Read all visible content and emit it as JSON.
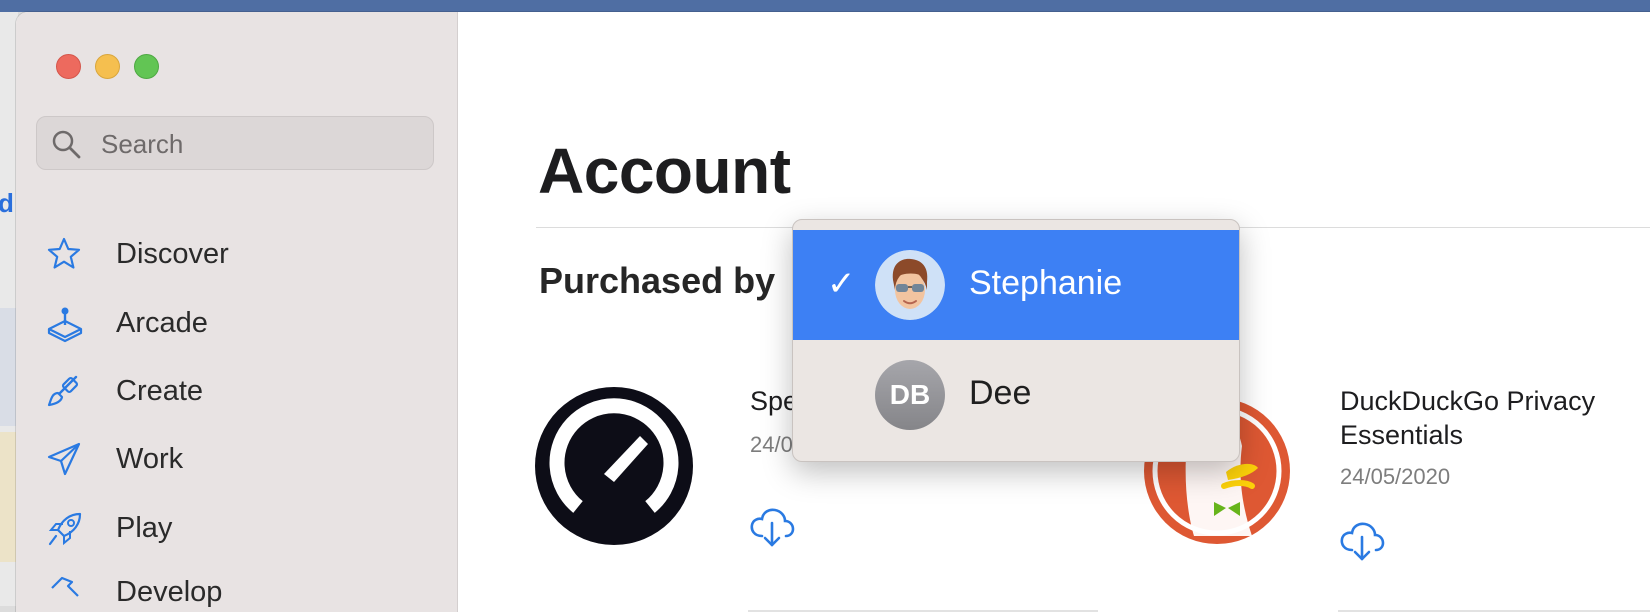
{
  "sidebar": {
    "search": {
      "placeholder": "Search",
      "icon": "search-icon"
    },
    "items": [
      {
        "label": "Discover",
        "icon": "star-icon"
      },
      {
        "label": "Arcade",
        "icon": "joystick-icon"
      },
      {
        "label": "Create",
        "icon": "paintbrush-icon"
      },
      {
        "label": "Work",
        "icon": "paper-plane-icon"
      },
      {
        "label": "Play",
        "icon": "rocket-icon"
      },
      {
        "label": "Develop",
        "icon": "hammer-icon"
      }
    ]
  },
  "main": {
    "title": "Account",
    "purchased_by_label": "Purchased by",
    "apps": [
      {
        "name": "Spee",
        "date": "24/05",
        "icon": "speedometer-icon"
      },
      {
        "name": "DuckDuckGo Privacy Essentials",
        "date": "24/05/2020",
        "icon": "duckduckgo-icon"
      }
    ]
  },
  "dropdown": {
    "options": [
      {
        "name": "Stephanie",
        "selected": true,
        "avatar": "memoji-avatar"
      },
      {
        "name": "Dee",
        "selected": false,
        "initials": "DB"
      }
    ],
    "check": "✓"
  },
  "background_window": {
    "visible_letter": "d"
  },
  "colors": {
    "accent": "#3d80f4",
    "link_blue": "#2a7ae2",
    "sidebar_bg": "#e8e3e3"
  }
}
